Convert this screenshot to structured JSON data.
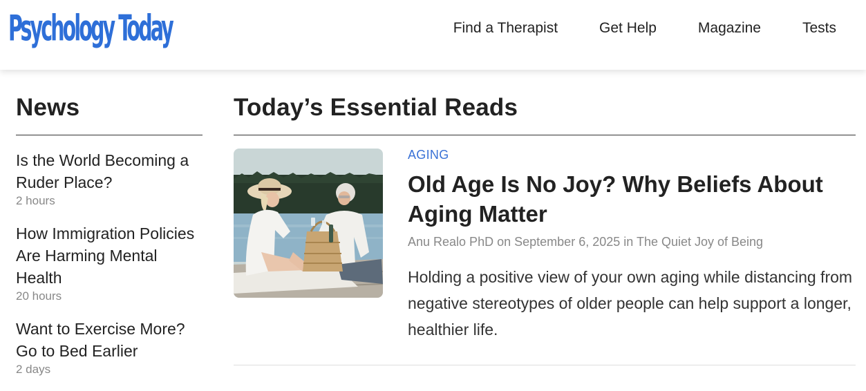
{
  "header": {
    "logo_text": "Psychology Today",
    "brand_color": "#2e6fd8",
    "nav": [
      {
        "label": "Find a Therapist"
      },
      {
        "label": "Get Help"
      },
      {
        "label": "Magazine"
      },
      {
        "label": "Tests"
      }
    ]
  },
  "news": {
    "heading": "News",
    "items": [
      {
        "title": "Is the World Becoming a Ruder Place?",
        "time": "2 hours"
      },
      {
        "title": "How Immigration Policies Are Harming Mental Health",
        "time": "20 hours"
      },
      {
        "title": "Want to Exercise More? Go to Bed Earlier",
        "time": "2 days"
      }
    ]
  },
  "essential_reads": {
    "heading": "Today’s Essential Reads",
    "article": {
      "category": "AGING",
      "title": "Old Age Is No Joy? Why Beliefs About Aging Matter",
      "author": "Anu Realo PhD",
      "date_prefix": "on",
      "date": "September 6, 2025",
      "blog_prefix": "in",
      "blog": "The Quiet Joy of Being",
      "teaser": "Holding a positive view of your own aging while distancing from negative stereotypes of older people can help support a longer, healthier life.",
      "image_icon": "photo-older-couple-picnic"
    }
  }
}
